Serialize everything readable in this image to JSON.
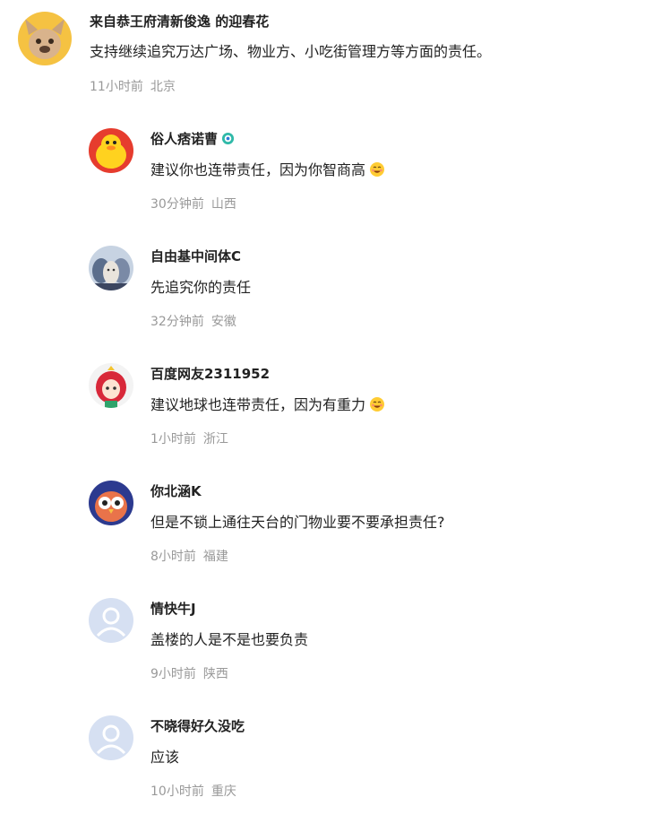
{
  "top_comment": {
    "user": "来自恭王府清新俊逸 的迎春花",
    "text": "支持继续追究万达广场、物业方、小吃街管理方等方面的责任。",
    "time": "11小时前",
    "location": "北京",
    "avatar": "dog-avatar"
  },
  "replies": [
    {
      "user": "俗人痞诺曹",
      "text": "建议你也连带责任，因为你智商高",
      "time": "30分钟前",
      "location": "山西",
      "avatar": "yellow-duck-avatar",
      "badge": "verified-badge-icon",
      "emoji": "grin-emoji"
    },
    {
      "user": "自由基中间体C",
      "text": "先追究你的责任",
      "time": "32分钟前",
      "location": "安徽",
      "avatar": "anime-group-avatar"
    },
    {
      "user": "百度网友2311952",
      "text": "建议地球也连带责任，因为有重力",
      "time": "1小时前",
      "location": "浙江",
      "avatar": "red-hair-girl-avatar",
      "emoji": "grin-emoji"
    },
    {
      "user": "你北涵K",
      "text": "但是不锁上通往天台的门物业要不要承担责任?",
      "time": "8小时前",
      "location": "福建",
      "avatar": "owl-avatar"
    },
    {
      "user": "情快牛J",
      "text": "盖楼的人是不是也要负责",
      "time": "9小时前",
      "location": "陕西",
      "avatar": "default-user-avatar"
    },
    {
      "user": "不晓得好久没吃",
      "text": "应该",
      "time": "10小时前",
      "location": "重庆",
      "avatar": "default-user-avatar"
    }
  ]
}
